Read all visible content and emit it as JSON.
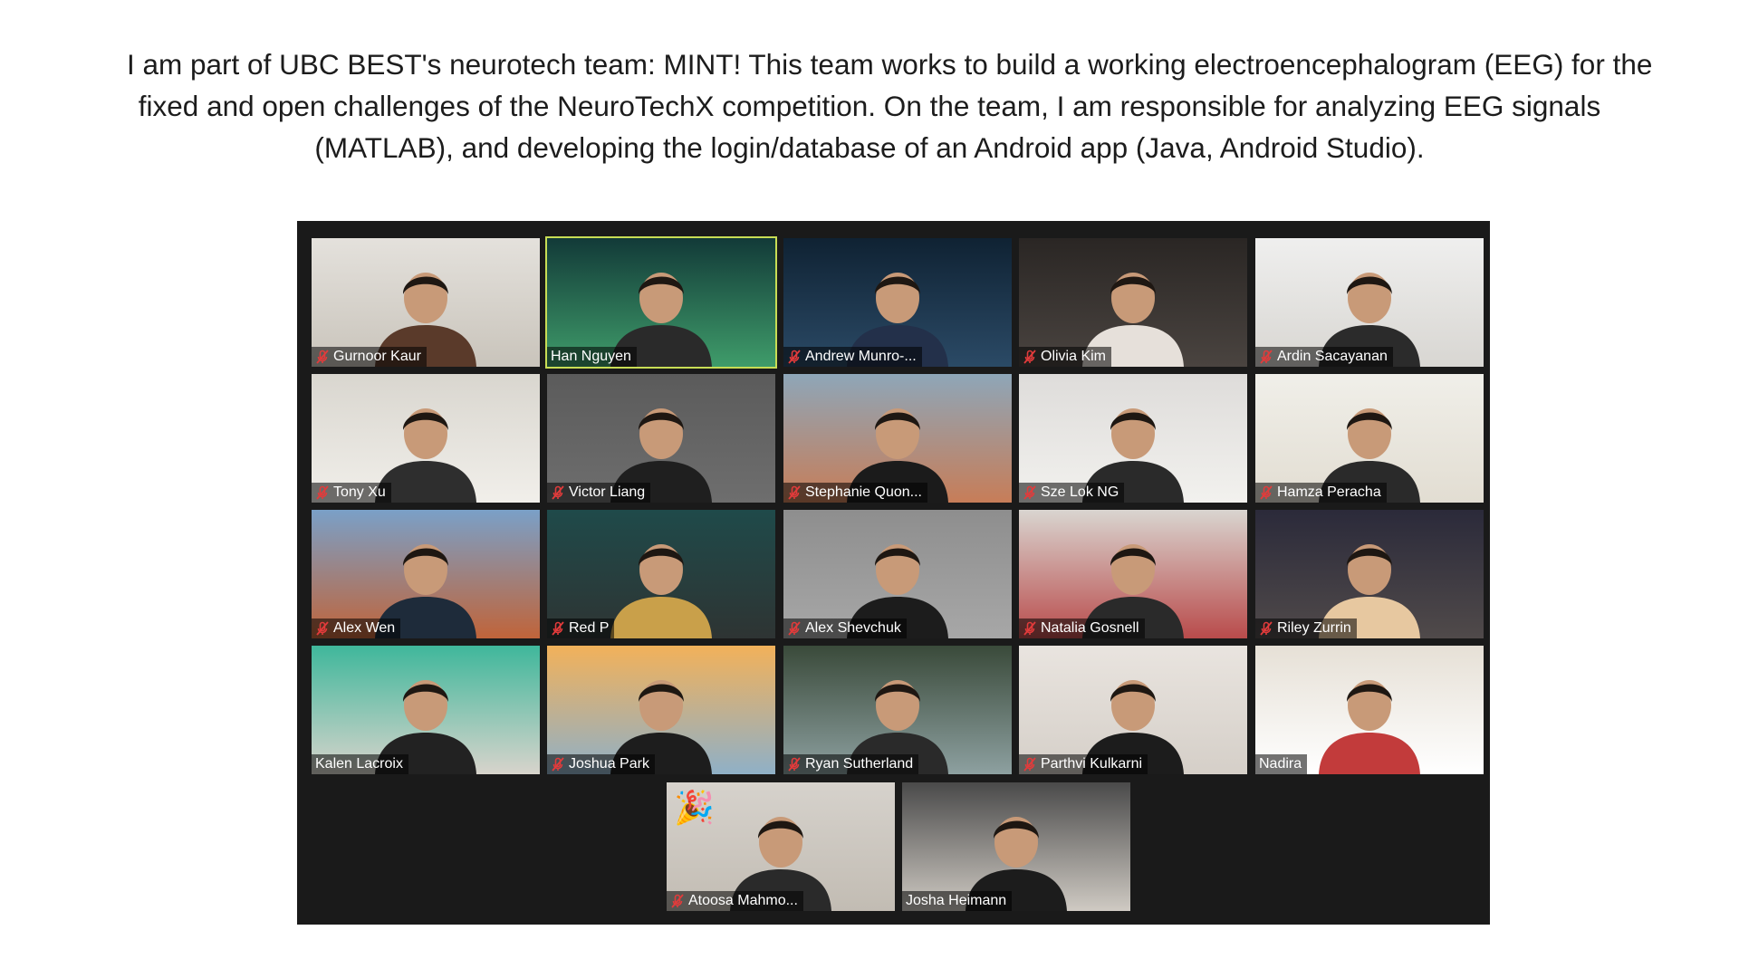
{
  "intro": {
    "line1": "I am part of UBC BEST's neurotech team: MINT! This team works to build a working electroencephalogram (EEG) for the",
    "line2": "fixed and open challenges of the NeuroTechX competition. On the team, I am responsible for analyzing EEG signals",
    "line3": "(MATLAB), and developing the login/database of an Android app (Java, Android Studio)."
  },
  "meeting": {
    "active_speaker_color": "#c8dd55",
    "muted_icon": "microphone-muted-icon",
    "participants": [
      {
        "name": "Gurnoor Kaur",
        "muted": true
      },
      {
        "name": "Han Nguyen",
        "muted": false,
        "active": true
      },
      {
        "name": "Andrew Munro-...",
        "muted": true
      },
      {
        "name": "Olivia Kim",
        "muted": true
      },
      {
        "name": "Ardin Sacayanan",
        "muted": true
      },
      {
        "name": "Tony Xu",
        "muted": true
      },
      {
        "name": "Victor Liang",
        "muted": true
      },
      {
        "name": "Stephanie Quon...",
        "muted": true
      },
      {
        "name": "Sze Lok NG",
        "muted": true
      },
      {
        "name": "Hamza Peracha",
        "muted": true
      },
      {
        "name": "Alex Wen",
        "muted": true
      },
      {
        "name": "Red P",
        "muted": true
      },
      {
        "name": "Alex Shevchuk",
        "muted": true
      },
      {
        "name": "Natalia Gosnell",
        "muted": true
      },
      {
        "name": "Riley Zurrin",
        "muted": true
      },
      {
        "name": "Kalen Lacroix",
        "muted": false
      },
      {
        "name": "Joshua Park",
        "muted": true
      },
      {
        "name": "Ryan Sutherland",
        "muted": true
      },
      {
        "name": "Parthvi Kulkarni",
        "muted": true
      },
      {
        "name": "Nadira",
        "muted": false
      },
      {
        "name": "Atoosa Mahmo...",
        "muted": true,
        "reaction": "party-popper-icon"
      },
      {
        "name": "Josha Heimann",
        "muted": false
      }
    ]
  }
}
